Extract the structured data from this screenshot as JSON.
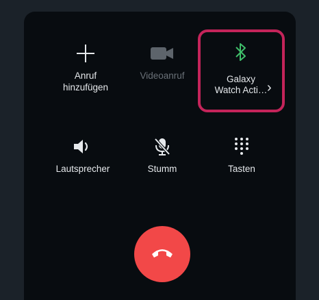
{
  "buttons": {
    "add_call": "Anruf\nhinzufügen",
    "video_call": "Videoanruf",
    "speaker": "Lautsprecher",
    "mute": "Stumm",
    "keypad": "Tasten"
  },
  "bluetooth": {
    "device_line1": "Galaxy",
    "device_line2": "Watch Acti…",
    "chevron": "›"
  },
  "colors": {
    "bluetooth": "#3fbf6a",
    "end_call": "#f24848",
    "highlight": "#c4245a"
  }
}
